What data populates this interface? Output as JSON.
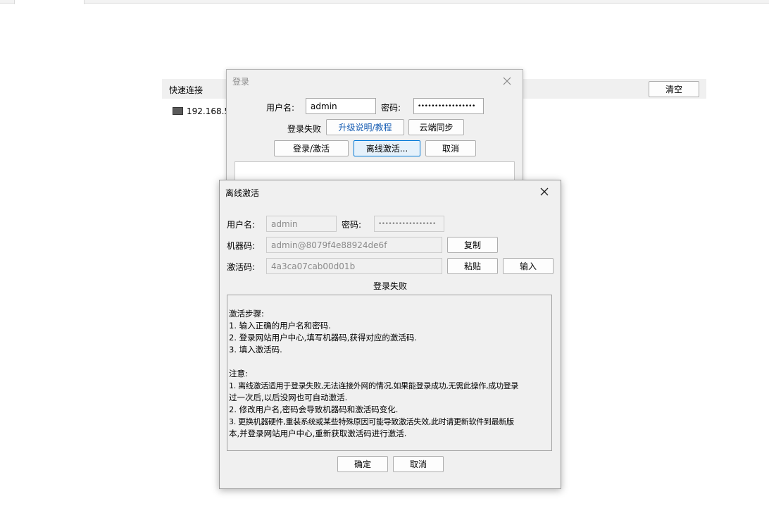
{
  "background": {
    "quick_connect_label": "快速连接",
    "clear_button": "清空",
    "host_item": "192.168.5."
  },
  "login_dialog": {
    "title": "登录",
    "username_label": "用户名:",
    "username_value": "admin",
    "password_label": "密码:",
    "password_value": "•••••••••••••••••",
    "status_text": "登录失败",
    "upgrade_button": "升级说明/教程",
    "cloud_sync_button": "云端同步",
    "login_button": "登录/激活",
    "offline_button": "离线激活...",
    "cancel_button": "取消"
  },
  "offline_dialog": {
    "title": "离线激活",
    "username_label": "用户名:",
    "username_value": "admin",
    "password_label": "密码:",
    "password_value": "•••••••••••••••••",
    "machine_code_label": "机器码:",
    "machine_code_value": "admin@8079f4e88924de6f",
    "copy_button": "复制",
    "activation_code_label": "激活码:",
    "activation_code_value": "4a3ca07cab00d01b",
    "paste_button": "粘贴",
    "input_button": "输入",
    "status_text": "登录失败",
    "instructions": [
      "",
      "激活步骤:",
      "1. 输入正确的用户名和密码.",
      "2. 登录网站用户中心,填写机器码,获得对应的激活码.",
      "3. 填入激活码.",
      "",
      "注意:",
      "1. 离线激活适用于登录失败,无法连接外网的情况,如果能登录成功,无需此操作,成功登录",
      "过一次后,以后没网也可自动激活.",
      "2. 修改用户名,密码会导致机器码和激活码变化.",
      "3. 更换机器硬件,重装系统或某些特殊原因可能导致激活失效,此时请更新软件到最新版",
      "本,并登录网站用户中心,重新获取激活码进行激活."
    ],
    "ok_button": "确定",
    "cancel_button": "取消"
  }
}
